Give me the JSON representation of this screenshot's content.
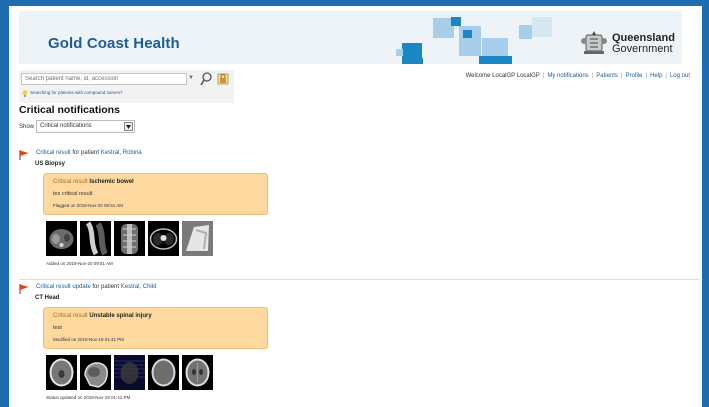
{
  "banner": {
    "brand": "Gold Coast Health",
    "gov_line1": "Queensland",
    "gov_line2": "Government",
    "colors": {
      "brand": "#1d5d96",
      "tile_dark": "#1b86c4",
      "tile_light": "#a7cfec"
    }
  },
  "search": {
    "placeholder": "Search patient name, id, accession",
    "hint": "Searching for patients with compound names?"
  },
  "nav": {
    "welcome": "Welcome LocalGP LocalGP",
    "links": [
      "My notifications",
      "Patients",
      "Profile",
      "Help",
      "Log out"
    ]
  },
  "page": {
    "title": "Critical notifications",
    "show_label": "Show",
    "show_value": "Critical notifications"
  },
  "notifications": [
    {
      "headline_link": "Critical result",
      "headline_mid": " for patient ",
      "patient": "Kestral, Robina",
      "exam": "US Biopsy",
      "card_label": "Critical result",
      "card_title": "Ischemic bowel",
      "card_note": "tes critical result",
      "card_meta": "Flagged on 2018-Nov-20 09:51 AM",
      "images": [
        "ct-abdomen-axial",
        "ct-spine-sagittal",
        "ct-abdomen-coronal",
        "ct-chest-axial",
        "xray-chest"
      ],
      "footer": "Added on 2018-Nov-20 09:51 AM"
    },
    {
      "headline_link": "Critical result update",
      "headline_mid": " for patient ",
      "patient": "Kestral, Child",
      "exam": "CT Head",
      "card_label": "Critical result",
      "card_title": "Unstable spinal injury",
      "card_note": "test",
      "card_meta": "Modified on 2018-Nov-19 01:41 PM",
      "images": [
        "ct-head-axial",
        "ct-head-sagittal",
        "ct-head-scout",
        "ct-head-axial-2",
        "ct-head-axial-3"
      ],
      "footer": "Status updated on 2018-Nov-19 01:41 PM"
    }
  ]
}
